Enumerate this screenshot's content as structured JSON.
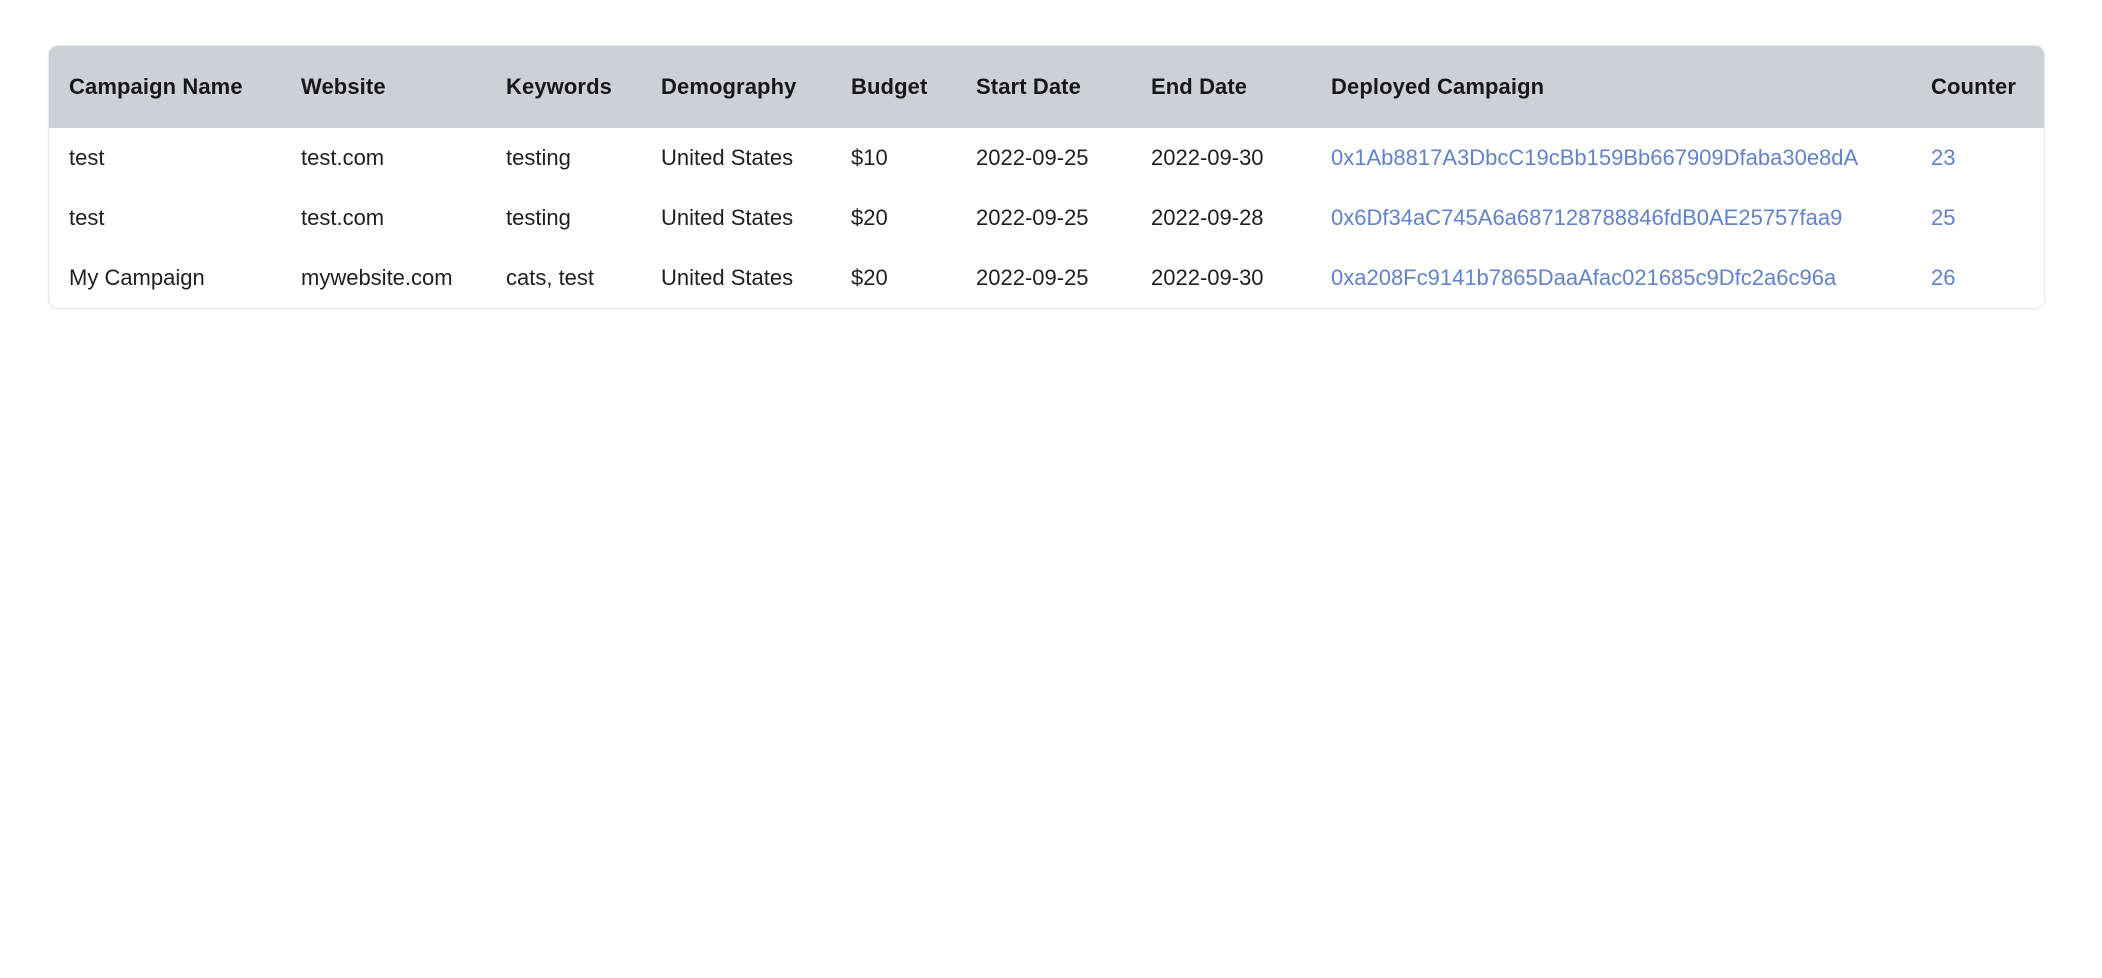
{
  "table": {
    "columns": [
      "Campaign Name",
      "Website",
      "Keywords",
      "Demography",
      "Budget",
      "Start Date",
      "End Date",
      "Deployed Campaign",
      "Counter"
    ],
    "rows": [
      {
        "campaign_name": "test",
        "website": "test.com",
        "keywords": "testing",
        "demography": "United States",
        "budget": "$10",
        "start_date": "2022-09-25",
        "end_date": "2022-09-30",
        "deployed_campaign": "0x1Ab8817A3DbcC19cBb159Bb667909Dfaba30e8dA",
        "counter": "23"
      },
      {
        "campaign_name": "test",
        "website": "test.com",
        "keywords": "testing",
        "demography": "United States",
        "budget": "$20",
        "start_date": "2022-09-25",
        "end_date": "2022-09-28",
        "deployed_campaign": "0x6Df34aC745A6a687128788846fdB0AE25757faa9",
        "counter": "25"
      },
      {
        "campaign_name": "My Campaign",
        "website": "mywebsite.com",
        "keywords": "cats, test",
        "demography": "United States",
        "budget": "$20",
        "start_date": "2022-09-25",
        "end_date": "2022-09-30",
        "deployed_campaign": "0xa208Fc9141b7865DaaAfac021685c9Dfc2a6c96a",
        "counter": "26"
      }
    ]
  },
  "colors": {
    "header_background": "#ccd0d7",
    "link": "#6282c9",
    "text": "#1f1f23",
    "page_background": "#ffffff",
    "card_border": "#e8e8ec"
  }
}
